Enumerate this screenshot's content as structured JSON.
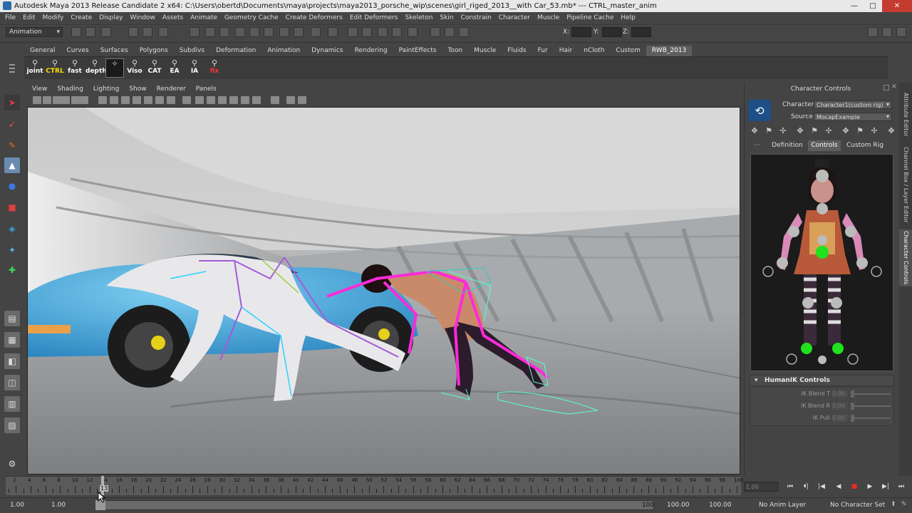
{
  "window": {
    "title": "Autodesk Maya 2013 Release Candidate 2 x64: C:\\Users\\obertd\\Documents\\maya\\projects\\maya2013_porsche_wip\\scenes\\girl_riged_2013__with Car_53.mb*   ---   CTRL_master_anim",
    "minimize": "—",
    "maximize": "□",
    "close": "✕"
  },
  "menubar": [
    "File",
    "Edit",
    "Modify",
    "Create",
    "Display",
    "Window",
    "Assets",
    "Animate",
    "Geometry Cache",
    "Create Deformers",
    "Edit Deformers",
    "Skeleton",
    "Skin",
    "Constrain",
    "Character",
    "Muscle",
    "Pipeline Cache",
    "Help"
  ],
  "statusline": {
    "mode": "Animation",
    "x_label": "X:",
    "y_label": "Y:",
    "z_label": "Z:"
  },
  "shelf": {
    "tabs": [
      "General",
      "Curves",
      "Surfaces",
      "Polygons",
      "Subdivs",
      "Deformation",
      "Animation",
      "Dynamics",
      "Rendering",
      "PaintEffects",
      "Toon",
      "Muscle",
      "Fluids",
      "Fur",
      "Hair",
      "nCloth",
      "Custom",
      "RWB_2013"
    ],
    "active_tab": "RWB_2013",
    "buttons": [
      "joint",
      "CTRL",
      "fast",
      "depth",
      "",
      "Viso",
      "CAT",
      "EA",
      "IA",
      "fix"
    ]
  },
  "viewport": {
    "menu": [
      "View",
      "Shading",
      "Lighting",
      "Show",
      "Renderer",
      "Panels"
    ]
  },
  "character_controls": {
    "title": "Character Controls",
    "character_label": "Character:",
    "character_value": "Character1(custom rig)",
    "source_label": "Source:",
    "source_value": "MocapExample",
    "tabs": [
      "Definition",
      "Controls",
      "Custom Rig"
    ],
    "active_tab": "Controls",
    "hik_section": "HumanIK Controls",
    "ik_rows": [
      {
        "label": "IK Blend T",
        "value": "0.00"
      },
      {
        "label": "IK Blend R",
        "value": "0.00"
      },
      {
        "label": "IK Pull",
        "value": "0.00"
      }
    ]
  },
  "side_tabs": [
    "Attribute Editor",
    "Channel Box / Layer Editor",
    "Character Controls"
  ],
  "timeline": {
    "ticks": [
      2,
      4,
      6,
      8,
      10,
      12,
      14,
      16,
      18,
      20,
      22,
      24,
      26,
      28,
      30,
      32,
      34,
      36,
      38,
      40,
      42,
      44,
      46,
      48,
      50,
      52,
      54,
      56,
      58,
      60,
      62,
      64,
      66,
      68,
      70,
      72,
      74,
      76,
      78,
      80,
      82,
      84,
      86,
      88,
      90,
      92,
      94,
      96,
      98,
      100
    ],
    "range_min": 1,
    "range_max": 100,
    "current_frame": "13",
    "current_time_field": "1.00"
  },
  "playback": [
    "⏮",
    "⏴|",
    "|◀",
    "◀",
    "■",
    "▶",
    "▶|",
    "⏭"
  ],
  "range": {
    "start_outer": "1.00",
    "start_inner": "1.00",
    "end_inner": "100",
    "end_field": "100.00",
    "end_outer": "100.00",
    "anim_layer": "No Anim Layer",
    "character_set": "No Character Set"
  },
  "colors": {
    "accent": "#5d5d5d",
    "stop": "#e52a2a",
    "hik_effector_active": "#1ee31e",
    "close_button": "#c43c30"
  }
}
